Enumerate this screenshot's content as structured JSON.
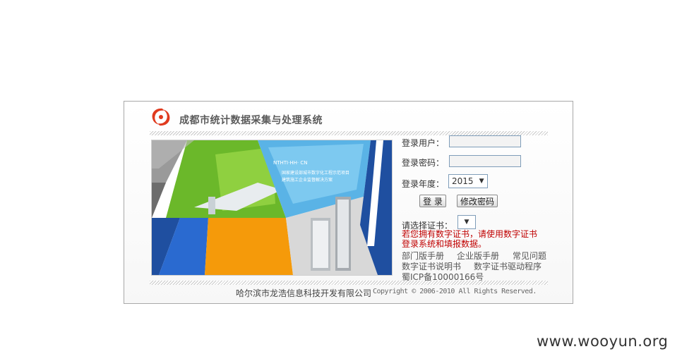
{
  "header": {
    "title": "成都市统计数据采集与处理系统",
    "logo_icon": "swirl-logo-icon",
    "brand_color": "#e03a1e"
  },
  "banner": {
    "text_line1": "国家建设部城市数字化工程示范项目",
    "text_line2": "建筑施工企业监督解决方案",
    "top_tag": "NTHTI·HH·  CN"
  },
  "login": {
    "user_label": "登录用户：",
    "user_value": "",
    "password_label": "登录密码：",
    "password_value": "",
    "year_label": "登录年度：",
    "year_value": "2015",
    "login_button": "登 录",
    "change_password_button": "修改密码",
    "cert_label": "请选择证书：",
    "cert_value": ""
  },
  "notice": "若您拥有数字证书，请使用数字证书登录系统和填报数据。",
  "links": {
    "dept_manual": "部门版手册",
    "enterprise_manual": "企业版手册",
    "faq": "常见问题",
    "cert_manual": "数字证书说明书",
    "cert_driver": "数字证书驱动程序",
    "icp": "蜀ICP备10000166号"
  },
  "footer": {
    "company": "哈尔滨市龙浩信息科技开发有限公司",
    "copyright": "Copyright © 2006-2010 All Rights Reserved."
  },
  "watermark": "www.wooyun.org"
}
